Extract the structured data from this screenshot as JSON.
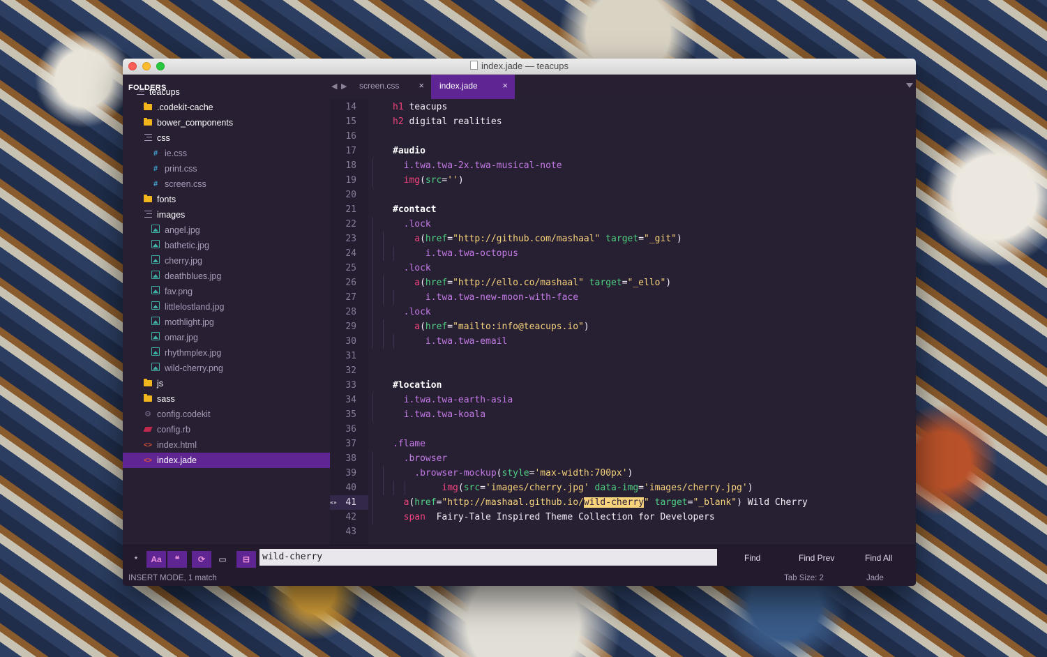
{
  "window": {
    "title": "index.jade — teacups"
  },
  "sidebar": {
    "header": "FOLDERS",
    "items": [
      {
        "label": "teacups",
        "type": "open-folder",
        "depth": 0
      },
      {
        "label": ".codekit-cache",
        "type": "folder",
        "depth": 1
      },
      {
        "label": "bower_components",
        "type": "folder",
        "depth": 1
      },
      {
        "label": "css",
        "type": "open-folder",
        "depth": 1
      },
      {
        "label": "ie.css",
        "type": "css",
        "depth": 2
      },
      {
        "label": "print.css",
        "type": "css",
        "depth": 2
      },
      {
        "label": "screen.css",
        "type": "css",
        "depth": 2
      },
      {
        "label": "fonts",
        "type": "folder",
        "depth": 1
      },
      {
        "label": "images",
        "type": "open-folder",
        "depth": 1
      },
      {
        "label": "angel.jpg",
        "type": "image",
        "depth": 2
      },
      {
        "label": "bathetic.jpg",
        "type": "image",
        "depth": 2
      },
      {
        "label": "cherry.jpg",
        "type": "image",
        "depth": 2
      },
      {
        "label": "deathblues.jpg",
        "type": "image",
        "depth": 2
      },
      {
        "label": "fav.png",
        "type": "image",
        "depth": 2
      },
      {
        "label": "littlelostland.jpg",
        "type": "image",
        "depth": 2
      },
      {
        "label": "mothlight.jpg",
        "type": "image",
        "depth": 2
      },
      {
        "label": "omar.jpg",
        "type": "image",
        "depth": 2
      },
      {
        "label": "rhythmplex.jpg",
        "type": "image",
        "depth": 2
      },
      {
        "label": "wild-cherry.png",
        "type": "image",
        "depth": 2
      },
      {
        "label": "js",
        "type": "folder",
        "depth": 1
      },
      {
        "label": "sass",
        "type": "folder",
        "depth": 1
      },
      {
        "label": "config.codekit",
        "type": "config",
        "depth": 1
      },
      {
        "label": "config.rb",
        "type": "ruby",
        "depth": 1
      },
      {
        "label": "index.html",
        "type": "code",
        "depth": 1
      },
      {
        "label": "index.jade",
        "type": "code",
        "depth": 1,
        "selected": true
      }
    ]
  },
  "tabs": [
    {
      "label": "screen.css",
      "active": false,
      "close": "×"
    },
    {
      "label": "index.jade",
      "active": true,
      "close": "×"
    }
  ],
  "editor": {
    "current_line": 41,
    "lines": [
      {
        "n": "14",
        "indent": 0,
        "tokens": [
          [
            "tag",
            "h1"
          ],
          [
            "txt",
            " teacups"
          ]
        ]
      },
      {
        "n": "15",
        "indent": 0,
        "tokens": [
          [
            "tag",
            "h2"
          ],
          [
            "txt",
            " digital realities"
          ]
        ]
      },
      {
        "n": "16",
        "indent": 0,
        "tokens": []
      },
      {
        "n": "17",
        "indent": 0,
        "tokens": [
          [
            "id",
            "#audio"
          ]
        ]
      },
      {
        "n": "18",
        "indent": 1,
        "tokens": [
          [
            "cls",
            "i.twa.twa-2x.twa-musical-note"
          ]
        ]
      },
      {
        "n": "19",
        "indent": 1,
        "tokens": [
          [
            "tag",
            "img"
          ],
          [
            "punc",
            "("
          ],
          [
            "attr",
            "src"
          ],
          [
            "punc",
            "="
          ],
          [
            "str",
            "''"
          ],
          [
            "punc",
            ")"
          ]
        ]
      },
      {
        "n": "20",
        "indent": 0,
        "tokens": []
      },
      {
        "n": "21",
        "indent": 0,
        "tokens": [
          [
            "id",
            "#contact"
          ]
        ]
      },
      {
        "n": "22",
        "indent": 1,
        "tokens": [
          [
            "cls",
            ".lock"
          ]
        ]
      },
      {
        "n": "23",
        "indent": 2,
        "tokens": [
          [
            "tag",
            "a"
          ],
          [
            "punc",
            "("
          ],
          [
            "attr",
            "href"
          ],
          [
            "punc",
            "="
          ],
          [
            "str",
            "\"http://github.com/mashaal\""
          ],
          [
            "txt",
            " "
          ],
          [
            "attr",
            "target"
          ],
          [
            "punc",
            "="
          ],
          [
            "str",
            "\"_git\""
          ],
          [
            "punc",
            ")"
          ]
        ]
      },
      {
        "n": "24",
        "indent": 3,
        "tokens": [
          [
            "cls",
            "i.twa.twa-octopus"
          ]
        ]
      },
      {
        "n": "25",
        "indent": 1,
        "tokens": [
          [
            "cls",
            ".lock"
          ]
        ]
      },
      {
        "n": "26",
        "indent": 2,
        "tokens": [
          [
            "tag",
            "a"
          ],
          [
            "punc",
            "("
          ],
          [
            "attr",
            "href"
          ],
          [
            "punc",
            "="
          ],
          [
            "str",
            "\"http://ello.co/mashaal\""
          ],
          [
            "txt",
            " "
          ],
          [
            "attr",
            "target"
          ],
          [
            "punc",
            "="
          ],
          [
            "str",
            "\"_ello\""
          ],
          [
            "punc",
            ")"
          ]
        ]
      },
      {
        "n": "27",
        "indent": 3,
        "tokens": [
          [
            "cls",
            "i.twa.twa-new-moon-with-face"
          ]
        ]
      },
      {
        "n": "28",
        "indent": 1,
        "tokens": [
          [
            "cls",
            ".lock"
          ]
        ]
      },
      {
        "n": "29",
        "indent": 2,
        "tokens": [
          [
            "tag",
            "a"
          ],
          [
            "punc",
            "("
          ],
          [
            "attr",
            "href"
          ],
          [
            "punc",
            "="
          ],
          [
            "str",
            "\"mailto:info@teacups.io\""
          ],
          [
            "punc",
            ")"
          ]
        ]
      },
      {
        "n": "30",
        "indent": 3,
        "tokens": [
          [
            "cls",
            "i.twa.twa-email"
          ]
        ]
      },
      {
        "n": "31",
        "indent": 0,
        "tokens": []
      },
      {
        "n": "32",
        "indent": 0,
        "tokens": []
      },
      {
        "n": "33",
        "indent": 0,
        "tokens": [
          [
            "id",
            "#location"
          ]
        ]
      },
      {
        "n": "34",
        "indent": 1,
        "tokens": [
          [
            "cls",
            "i.twa.twa-earth-asia"
          ]
        ]
      },
      {
        "n": "35",
        "indent": 1,
        "tokens": [
          [
            "cls",
            "i.twa.twa-koala"
          ]
        ]
      },
      {
        "n": "36",
        "indent": 0,
        "tokens": []
      },
      {
        "n": "37",
        "indent": 0,
        "tokens": [
          [
            "cls",
            ".flame"
          ]
        ]
      },
      {
        "n": "38",
        "indent": 1,
        "tokens": [
          [
            "cls",
            ".browser"
          ]
        ]
      },
      {
        "n": "39",
        "indent": 2,
        "tokens": [
          [
            "cls",
            ".browser-mockup"
          ],
          [
            "punc",
            "("
          ],
          [
            "attr",
            "style"
          ],
          [
            "punc",
            "="
          ],
          [
            "str",
            "'max-width:700px'"
          ],
          [
            "punc",
            ")"
          ]
        ]
      },
      {
        "n": "40",
        "indent": 3,
        "extra": 1,
        "tokens": [
          [
            "tag",
            "img"
          ],
          [
            "punc",
            "("
          ],
          [
            "attr",
            "src"
          ],
          [
            "punc",
            "="
          ],
          [
            "str",
            "'images/cherry.jpg'"
          ],
          [
            "txt",
            " "
          ],
          [
            "attr",
            "data-img"
          ],
          [
            "punc",
            "="
          ],
          [
            "str",
            "'images/cherry.jpg'"
          ],
          [
            "punc",
            ")"
          ]
        ]
      },
      {
        "n": "41",
        "indent": 1,
        "fold": "«»",
        "tokens": [
          [
            "tag",
            "a"
          ],
          [
            "punc",
            "("
          ],
          [
            "attr",
            "href"
          ],
          [
            "punc",
            "="
          ],
          [
            "str",
            "\"http://mashaal.github.io/"
          ],
          [
            "match",
            "wild-cherry"
          ],
          [
            "str",
            "\""
          ],
          [
            "txt",
            " "
          ],
          [
            "attr",
            "target"
          ],
          [
            "punc",
            "="
          ],
          [
            "str",
            "\"_blank\""
          ],
          [
            "punc",
            ")"
          ],
          [
            "txt",
            " Wild Cherry"
          ]
        ]
      },
      {
        "n": "42",
        "indent": 1,
        "tokens": [
          [
            "tag",
            "span"
          ],
          [
            "txt",
            "  Fairy-Tale Inspired Theme Collection for Developers"
          ]
        ]
      },
      {
        "n": "43",
        "indent": 0,
        "tokens": []
      }
    ]
  },
  "findbar": {
    "regex_label": "*",
    "case_label": "Aa",
    "word_label": "❝",
    "wrap_label": "⟳",
    "selection_label": "▭",
    "highlight_label": "⊟",
    "query": "wild-cherry",
    "find_label": "Find",
    "find_prev_label": "Find Prev",
    "find_all_label": "Find All"
  },
  "status": {
    "mode": "INSERT MODE, 1 match",
    "tab_size": "Tab Size: 2",
    "syntax": "Jade"
  }
}
